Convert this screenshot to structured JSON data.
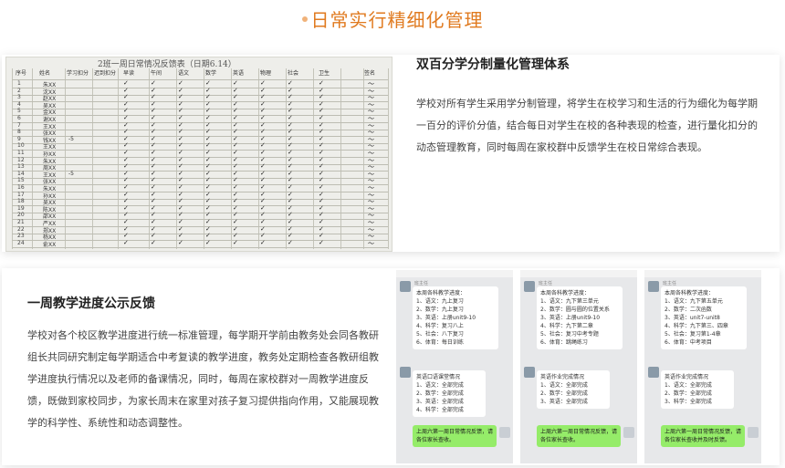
{
  "page": {
    "title": "日常实行精细化管理"
  },
  "section1": {
    "title": "双百分学分制量化管理体系",
    "body": "学校对所有学生采用学分制管理，将学生在校学习和生活的行为细化为每学期一百分的评价分值，结合每日对学生在校的各种表现的检查，进行量化扣分的动态管理教育，同时每周在家校群中反馈学生在校日常综合表现。"
  },
  "sheet": {
    "heading": "2班一周日常情况反馈表（日期6.14）",
    "headers": [
      "序号",
      "姓名",
      "学习扣分",
      "迟到扣分",
      "早读",
      "午间",
      "语文",
      "数学",
      "英语",
      "物理",
      "社会",
      "卫生",
      "签名"
    ],
    "names": [
      "朱XX",
      "沈XX",
      "赵XX",
      "吴XX",
      "金XX",
      "谢XX",
      "王XX",
      "张XX",
      "钱XX",
      "王XX",
      "孙XX",
      "朱XX",
      "周XX",
      "王XX",
      "张XX",
      "朱XX",
      "孙XX",
      "吴XX",
      "陈XX",
      "邵XX",
      "严XX",
      "郑XX",
      "杨XX",
      "俞XX"
    ],
    "deductions": {
      "row9": "-5",
      "row14": "-5"
    }
  },
  "section2": {
    "title": "一周教学进度公示反馈",
    "body": "学校对各个校区教学进度进行统一标准管理，每学期开学前由教务处会同各教研组长共同研究制定每学期适合中考复读的教学进度，教务处定期检查各教研组教学进度执行情况以及老师的备课情况，同时，每周在家校群对一周教学进度反馈，既做到家校同步，为家长周末在家里对孩子复习提供指向作用，又能展现教学的科学性、系统性和动态调整性。"
  },
  "chats": [
    {
      "sender": "班主任",
      "lines": [
        "本周各科教学进度：",
        "1、语文：九上复习",
        "2、数学：九上复习",
        "3、英语：上册unit9-10",
        "4、科学：复习八上",
        "5、社会：八下复习",
        "6、体育：每日训练"
      ],
      "reply_lines": [
        "英语口语课堂情况",
        "1、语文：全部完成",
        "2、数学：全部完成",
        "3、英语：全部完成",
        "4、科学：全部完成"
      ],
      "green": "上周六第一周日常情况反馈，请各位家长查收。"
    },
    {
      "sender": "班主任",
      "lines": [
        "本周各科教学进度：",
        "1、语文：九下第三单元",
        "2、数学：圆与圆的位置关系",
        "3、英语：上册unit9-10",
        "4、科学：九下第二章",
        "5、社会：复习中考专题",
        "6、体育：跳绳练习"
      ],
      "reply_lines": [
        "英语作业完成情况",
        "1、语文：全部完成",
        "2、数学：全部完成",
        "3、英语：全部完成"
      ],
      "green": "上周六第一周日常情况反馈，请各位家长查收。"
    },
    {
      "sender": "班主任",
      "lines": [
        "本周各科教学进度：",
        "1、语文：九下第五单元",
        "2、数学：二次函数",
        "3、英语：unit7-unit8",
        "4、科学：九下第三、四章",
        "5、社会：复习第1-4章",
        "6、体育：中考项目"
      ],
      "reply_lines": [
        "英语作业完成情况",
        "1、语文：全部完成",
        "2、数学：全部完成",
        "3、科学：全部完成"
      ],
      "green": "上周六第一周日常情况反馈，请各位家长查收并及时反馈。"
    }
  ]
}
